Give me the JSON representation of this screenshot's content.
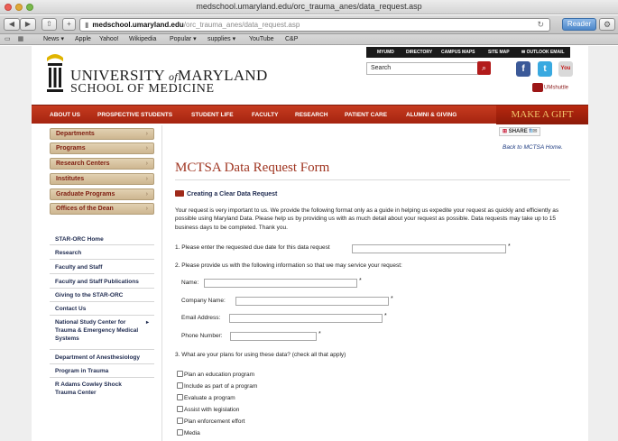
{
  "browser": {
    "window_title": "medschool.umaryland.edu/orc_trauma_anes/data_request.asp",
    "url_domain": "medschool.umaryland.edu",
    "url_path": "/orc_trauma_anes/data_request.asp",
    "reader_label": "Reader",
    "bookmarks": [
      "News ▾",
      "Apple",
      "Yahoo!",
      "Wikipedia",
      "Popular ▾",
      "supplies ▾",
      "YouTube",
      "C&P"
    ]
  },
  "header": {
    "logo_line1_a": "UNIVERSITY",
    "logo_line1_of": "of",
    "logo_line1_b": "MARYLAND",
    "logo_line2": "SCHOOL OF MEDICINE",
    "utility_links": [
      "MYUMD",
      "DIRECTORY",
      "CAMPUS MAPS",
      "SITE MAP",
      "✉ OUTLOOK EMAIL"
    ],
    "search_placeholder": "Search",
    "shuttle_label": "UMshuttle"
  },
  "nav": {
    "items": [
      "ABOUT US",
      "PROSPECTIVE STUDENTS",
      "STUDENT LIFE",
      "FACULTY",
      "RESEARCH",
      "PATIENT CARE",
      "ALUMNI & GIVING"
    ],
    "gift": "MAKE A GIFT"
  },
  "sidebar": {
    "tabs": [
      "Departments",
      "Programs",
      "Research Centers",
      "Institutes",
      "Graduate Programs",
      "Offices of the Dean"
    ],
    "links": [
      "STAR-ORC Home",
      "Research",
      "Faculty and Staff",
      "Faculty and Staff Publications",
      "Giving to the STAR-ORC",
      "Contact Us",
      "National Study Center for",
      "Trauma & Emergency Medical",
      "Systems",
      "Department of Anesthesiology",
      "Program in Trauma",
      "R Adams Cowley Shock",
      "Trauma Center"
    ]
  },
  "main": {
    "share_label": "SHARE",
    "back_link": "Back to MCTSA Home.",
    "title": "MCTSA Data Request Form",
    "subheading": "Creating a Clear Data Request",
    "intro": "Your request is very important to us.  We provide the following format only as a guide in helping us expedite your request as quickly and efficiently as possible using Maryland Data.  Please help us by providing us with as much detail about your request as possible.  Data requests may take up to 15 business days to be completed.  Thank you.",
    "q1": "1.  Please enter the requested due date for this data request",
    "q2": "2.  Please provide us with the following information so that we may service your request:",
    "fields": [
      "Name:",
      "Company Name:",
      "Email Address:",
      "Phone Number:"
    ],
    "required_mark": "*",
    "q3": "3.  What are your plans for using these data? (check all that apply)",
    "options": [
      "Plan an education program",
      "Include as part of a program",
      "Evaluate a program",
      "Assist with legislation",
      "Plan enforcement effort",
      "Media"
    ]
  }
}
